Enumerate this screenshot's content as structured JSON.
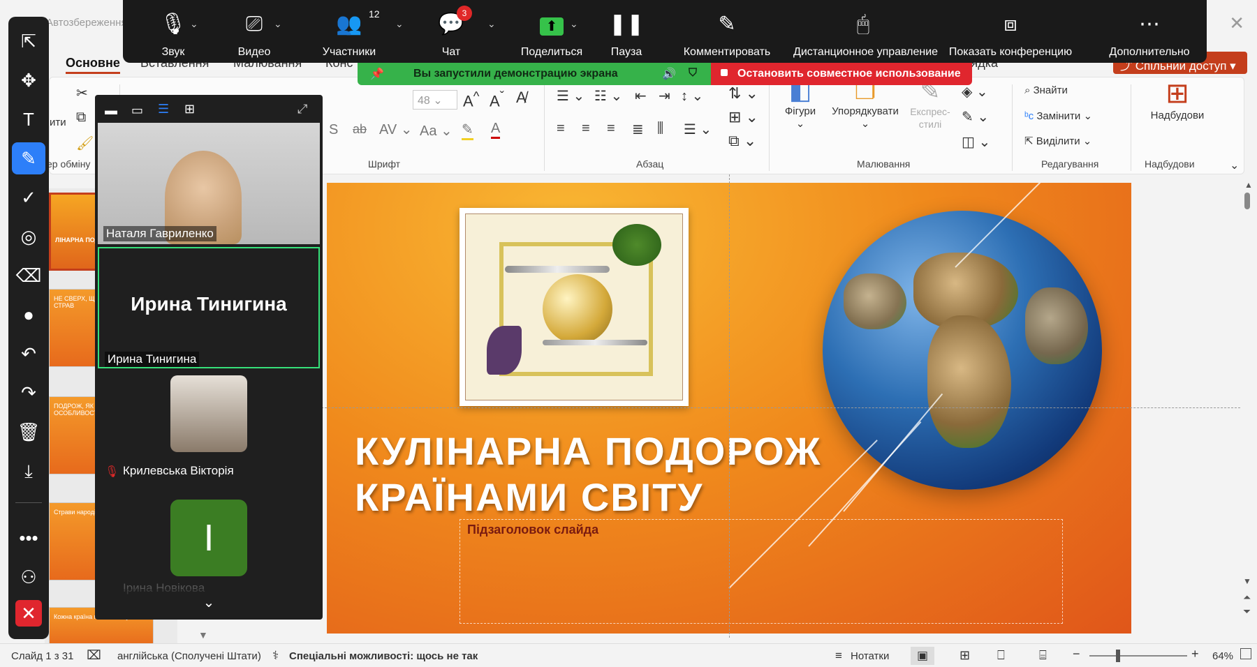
{
  "window": {
    "autosave_label": "Автозбереження",
    "close": "✕"
  },
  "ribbon_tabs": [
    {
      "label": "Основне",
      "active": true
    },
    {
      "label": "Вставлення"
    },
    {
      "label": "Малювання"
    },
    {
      "label": "Конс"
    },
    {
      "label": "лядка"
    }
  ],
  "share_button": "Спільний доступ",
  "ribbon": {
    "clipboard": {
      "paste": "ити",
      "label": "ер обміну"
    },
    "font": {
      "size": "48",
      "label": "Шрифт"
    },
    "paragraph": {
      "label": "Абзац"
    },
    "drawing": {
      "shapes": "Фігури",
      "arrange": "Упорядкувати",
      "express_styles": "Експрес-стилі",
      "label": "Малювання"
    },
    "editing": {
      "find": "Знайти",
      "replace": "Замінити",
      "select": "Виділити",
      "label": "Редагування"
    },
    "addins": {
      "button": "Надбудови",
      "label": "Надбудови"
    }
  },
  "slide": {
    "title_line1": "КУЛІНАРНА ПОДОРОЖ",
    "title_line2": "КРАЇНАМИ СВІТУ",
    "subtitle_placeholder": "Підзаголовок слайда"
  },
  "thumbnails": [
    {
      "text": "ЛІНАРНА ПОД КРАЇНАМИ СВІТ",
      "selected": true
    },
    {
      "text": "НЕ СВЕРХ, ЩО У СВ РОЗМАЇТЕ СТРАВ"
    },
    {
      "text": "ПОДРОЖ, ЯК СКЛАД НАЦІОНАЛ ОСОБЛИВОСТІ"
    },
    {
      "text": "Страви народів світу"
    },
    {
      "text": "Кожна країна має свою кухню"
    }
  ],
  "status_bar": {
    "slide_info": "Слайд 1 з 31",
    "language": "англійська (Сполучені Штати)",
    "accessibility": "Спеціальні можливості: щось не так",
    "notes": "Нотатки",
    "zoom": "64%"
  },
  "zoom_toolbar": {
    "audio": "Звук",
    "video": "Видео",
    "participants": "Участники",
    "participants_count": "12",
    "chat": "Чат",
    "chat_badge": "3",
    "share": "Поделиться",
    "pause": "Пауза",
    "annotate": "Комментировать",
    "remote_control": "Дистанционное управление",
    "show_conference": "Показать конференцию",
    "more": "Дополнительно"
  },
  "share_banner": {
    "status": "Вы запустили демонстрацию экрана",
    "stop": "Остановить совместное использование"
  },
  "participants_panel": {
    "tiles": [
      {
        "name": "Наталя Гавриленко"
      },
      {
        "name": "Ирина Тинигина",
        "big_name": "Ирина Тинигина"
      },
      {
        "name": "Крилевська Вікторія"
      },
      {
        "name": "Ірина Новікова",
        "initial": "І"
      }
    ]
  },
  "colors": {
    "accent": "#c43e1c",
    "zoom_green": "#36b24a",
    "zoom_red": "#e0262e",
    "annot_active": "#2d7ff9"
  }
}
